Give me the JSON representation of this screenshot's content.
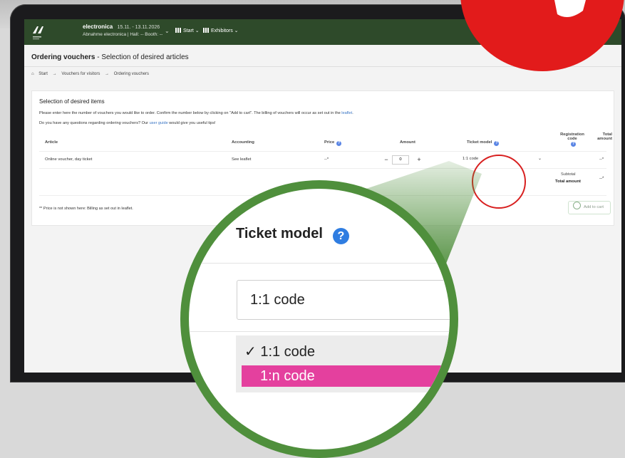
{
  "header": {
    "event_name": "electronica",
    "event_dates": "15.11. - 13.11.2026",
    "event_sub": "Abnahme electronica | Hall: -- Booth: --",
    "nav": [
      {
        "label": "Start"
      },
      {
        "label": "Exhibitors"
      }
    ]
  },
  "page": {
    "title_bold": "Ordering vouchers",
    "title_rest": " - Selection of desired articles",
    "breadcrumb": [
      "Start",
      "→",
      "Vouchers for visitors",
      "→",
      "Ordering vouchers"
    ]
  },
  "card": {
    "title": "Selection of desired items",
    "intro_text": "Please enter here the number of vouchers you would like to order. Confirm the number below by clicking on \"Add to cart\". The billing of vouchers will occur as set out in the",
    "intro_link": "leaflet",
    "question_text": "Do you have any questions regarding ordering vouchers? Our",
    "question_link": "user guide",
    "question_tail": "would give you useful tips!",
    "columns": {
      "article": "Article",
      "accounting": "Accounting",
      "price": "Price",
      "amount": "Amount",
      "ticket_model": "Ticket model",
      "registration_code": "Registration code",
      "total_amount": "Total amount"
    },
    "row": {
      "article": "Online voucher, day ticket",
      "accounting": "See leaflet",
      "price": "--*",
      "minus": "−",
      "qty": "0",
      "plus": "+",
      "ticket_model": "1:1 code",
      "total": "--*"
    },
    "subtotal_label": "Subtotal",
    "total_label": "Total amount",
    "subtotal_value": "--*",
    "note": "** Price is not shown here: Billing as set out in leaflet.",
    "add_to_cart": "Add to cart"
  },
  "zoom": {
    "header": "Ticket model",
    "help": "?",
    "selected": "1:1 code",
    "options": [
      "✓ 1:1 code",
      "1:n code"
    ]
  },
  "colors": {
    "topbar": "#2e4a2a",
    "zoom_ring": "#4f8f3c",
    "highlight_option": "#e4409e",
    "red_accent": "#e21b1b",
    "link": "#3a75c4"
  }
}
